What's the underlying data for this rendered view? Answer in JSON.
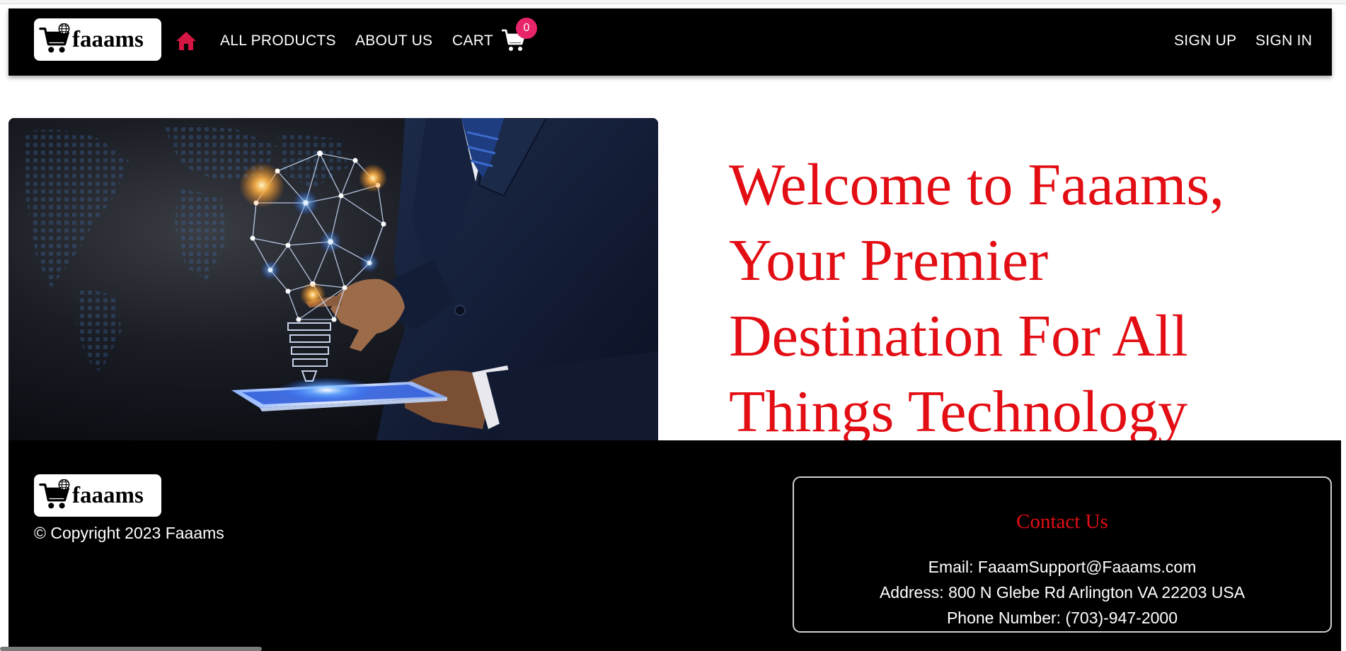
{
  "colors": {
    "accent_red": "#e30d14",
    "home_icon": "#d41642",
    "badge_pink": "#e8246a",
    "navbar_bg": "#000000",
    "footer_bg": "#000000"
  },
  "brand": {
    "logo_text": "faaams",
    "logo_icon": "shopping-cart-globe-icon"
  },
  "navbar": {
    "home_icon": "home-icon",
    "links": {
      "all_products": "ALL PRODUCTS",
      "about_us": "ABOUT US",
      "cart": "CART"
    },
    "cart_icon": "shopping-cart-icon",
    "cart_count": "0",
    "sign_up": "SIGN UP",
    "sign_in": "SIGN IN"
  },
  "hero": {
    "image_description_icon": "lightbulb-network-tablet-image",
    "title": "Welcome to Faaams, Your Premier Destination For All Things Technology"
  },
  "footer": {
    "copyright": "© Copyright 2023 Faaams",
    "contact": {
      "title": "Contact Us",
      "email": "Email: FaaamSupport@Faaams.com",
      "address": "Address: 800 N Glebe Rd Arlington VA 22203 USA",
      "phone": "Phone Number: (703)-947-2000"
    }
  }
}
